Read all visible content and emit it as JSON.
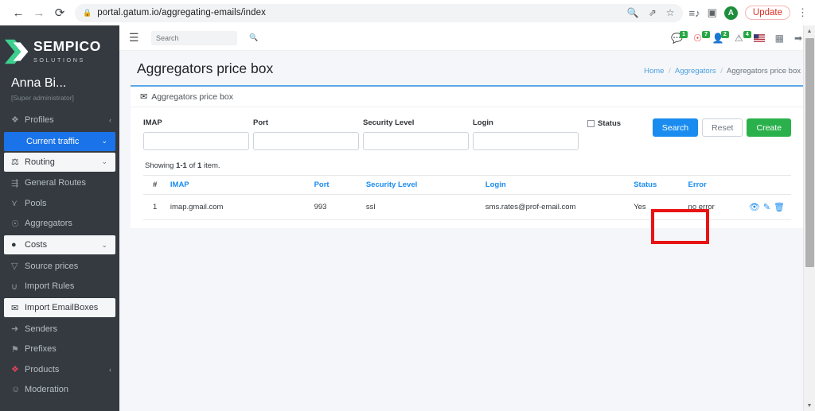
{
  "browser": {
    "back_icon": "back-arrow-icon",
    "forward_icon": "forward-arrow-icon",
    "reload_icon": "reload-icon",
    "lock_icon": "lock-icon",
    "url": "portal.gatum.io/aggregating-emails/index",
    "toolbar_icons": [
      "search-icon",
      "share-icon",
      "bookmark-star-icon",
      "reading-list-icon",
      "side-panel-icon"
    ],
    "profile_initial": "A",
    "update_label": "Update",
    "menu_icon": "kebab-menu-icon"
  },
  "sidebar": {
    "brand": {
      "name": "SEMPICO",
      "subtitle": "SOLUTIONS"
    },
    "user": {
      "name": "Anna Bi...",
      "role": "[Super administrator]"
    },
    "items": [
      {
        "label": "Profiles",
        "icon": "profiles-icon",
        "chevron": "‹",
        "state": "normal"
      },
      {
        "label": "Current traffic",
        "icon": "",
        "chevron": "⌄",
        "state": "active"
      },
      {
        "label": "Routing",
        "icon": "routing-icon",
        "chevron": "⌄",
        "state": "light"
      },
      {
        "label": "General Routes",
        "icon": "general-routes-icon",
        "chevron": "",
        "state": "normal"
      },
      {
        "label": "Pools",
        "icon": "pools-icon",
        "chevron": "",
        "state": "normal"
      },
      {
        "label": "Aggregators",
        "icon": "aggregators-icon",
        "chevron": "",
        "state": "normal"
      },
      {
        "label": "Costs",
        "icon": "costs-icon",
        "chevron": "⌄",
        "state": "light"
      },
      {
        "label": "Source prices",
        "icon": "source-prices-icon",
        "chevron": "",
        "state": "normal"
      },
      {
        "label": "Import Rules",
        "icon": "import-rules-icon",
        "chevron": "",
        "state": "normal"
      },
      {
        "label": "Import EmailBoxes",
        "icon": "import-emailboxes-icon",
        "chevron": "",
        "state": "light"
      },
      {
        "label": "Senders",
        "icon": "senders-icon",
        "chevron": "",
        "state": "normal"
      },
      {
        "label": "Prefixes",
        "icon": "prefixes-icon",
        "chevron": "",
        "state": "normal"
      },
      {
        "label": "Products",
        "icon": "products-icon",
        "chevron": "‹",
        "state": "normal"
      },
      {
        "label": "Moderation",
        "icon": "moderation-icon",
        "chevron": "",
        "state": "normal"
      }
    ]
  },
  "header": {
    "burger_icon": "hamburger-menu-icon",
    "search_placeholder": "Search",
    "search_value": "",
    "search_icon": "search-icon",
    "notifications": [
      {
        "icon": "messages-icon",
        "badge": "1"
      },
      {
        "icon": "tickets-icon",
        "badge": "7"
      },
      {
        "icon": "users-icon",
        "badge": "2"
      },
      {
        "icon": "alerts-icon",
        "badge": "4"
      }
    ],
    "language_icon": "us-flag-icon",
    "apps_icon": "grid-apps-icon",
    "logout_icon": "logout-icon"
  },
  "page": {
    "title": "Aggregators price box",
    "breadcrumb": [
      {
        "label": "Home",
        "link": true
      },
      {
        "label": "Aggregators",
        "link": true
      },
      {
        "label": "Aggregators price box",
        "link": false
      }
    ]
  },
  "card": {
    "header_icon": "mailbox-icon",
    "header_title": "Aggregators price box",
    "filters": [
      {
        "label": "IMAP",
        "value": "",
        "name": "imap-field"
      },
      {
        "label": "Port",
        "value": "",
        "name": "port-field"
      },
      {
        "label": "Security Level",
        "value": "",
        "name": "security-level-field"
      },
      {
        "label": "Login",
        "value": "",
        "name": "login-field"
      }
    ],
    "status": {
      "label": "Status",
      "checked": false
    },
    "buttons": {
      "search": "Search",
      "reset": "Reset",
      "create": "Create"
    }
  },
  "results": {
    "showing_prefix": "Showing ",
    "showing_range": "1-1",
    "showing_mid": " of ",
    "showing_count": "1",
    "showing_suffix": " item.",
    "columns": [
      "#",
      "IMAP",
      "Port",
      "Security Level",
      "Login",
      "Status",
      "Error",
      ""
    ],
    "rows": [
      {
        "num": "1",
        "imap": "imap.gmail.com",
        "port": "993",
        "security": "ssl",
        "login": "sms.rates@prof-email.com",
        "status": "Yes",
        "error": "no error",
        "actions": [
          "view-icon",
          "edit-icon",
          "delete-icon"
        ]
      }
    ]
  },
  "annotation": {
    "highlight_color": "#e81313",
    "target": "no error"
  }
}
